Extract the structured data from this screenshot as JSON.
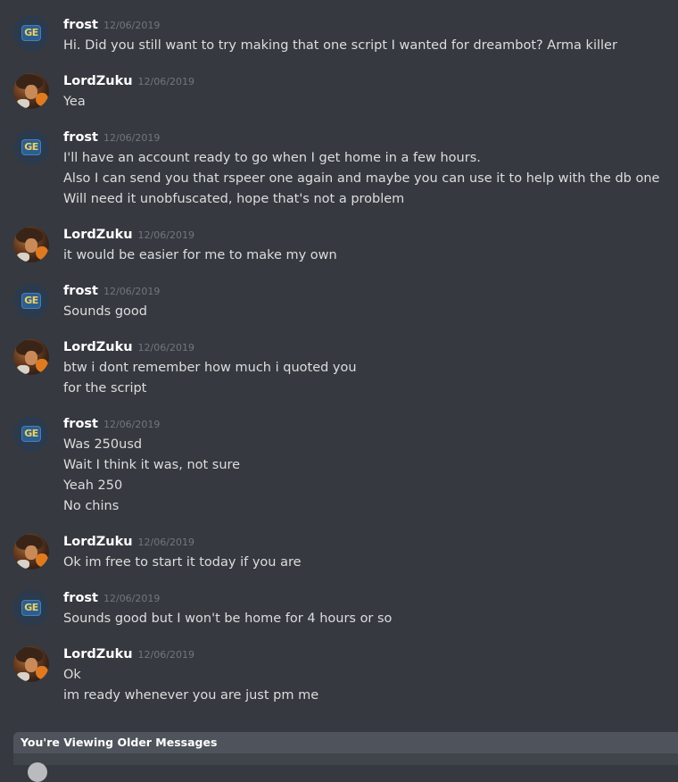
{
  "messages": [
    {
      "author": "frost",
      "avatar": "ge-logo-avatar",
      "timestamp": "12/06/2019",
      "lines": [
        "Hi. Did you still want to try making that one script I wanted for dreambot? Arma killer"
      ]
    },
    {
      "author": "LordZuku",
      "avatar": "anime-character-avatar",
      "timestamp": "12/06/2019",
      "lines": [
        "Yea"
      ]
    },
    {
      "author": "frost",
      "avatar": "ge-logo-avatar",
      "timestamp": "12/06/2019",
      "lines": [
        "I'll have an account ready to go when I get home in a few hours.",
        "Also I can send you that rspeer one again and maybe you can use it to help with the db one",
        "Will need it unobfuscated, hope that's not a problem"
      ]
    },
    {
      "author": "LordZuku",
      "avatar": "anime-character-avatar",
      "timestamp": "12/06/2019",
      "lines": [
        "it would be easier for me to make my own"
      ]
    },
    {
      "author": "frost",
      "avatar": "ge-logo-avatar",
      "timestamp": "12/06/2019",
      "lines": [
        "Sounds good"
      ]
    },
    {
      "author": "LordZuku",
      "avatar": "anime-character-avatar",
      "timestamp": "12/06/2019",
      "lines": [
        "btw i dont remember how much i quoted you",
        "for the script"
      ]
    },
    {
      "author": "frost",
      "avatar": "ge-logo-avatar",
      "timestamp": "12/06/2019",
      "lines": [
        "Was 250usd",
        "Wait I think it was, not sure",
        "Yeah 250",
        "No chins"
      ]
    },
    {
      "author": "LordZuku",
      "avatar": "anime-character-avatar",
      "timestamp": "12/06/2019",
      "lines": [
        "Ok im free to start it today if you are"
      ]
    },
    {
      "author": "frost",
      "avatar": "ge-logo-avatar",
      "timestamp": "12/06/2019",
      "lines": [
        "Sounds good but I won't be home for 4 hours or so"
      ]
    },
    {
      "author": "LordZuku",
      "avatar": "anime-character-avatar",
      "timestamp": "12/06/2019",
      "lines": [
        "Ok",
        "im ready whenever you are just pm me"
      ]
    }
  ],
  "avatar_logo_text": "GE",
  "notice": {
    "text": "You're Viewing Older Messages"
  },
  "colors": {
    "background": "#36393f",
    "username": "#ffffff",
    "message_text": "#dcddde",
    "timestamp": "#72767d",
    "notice_bar": "#4f545c"
  }
}
